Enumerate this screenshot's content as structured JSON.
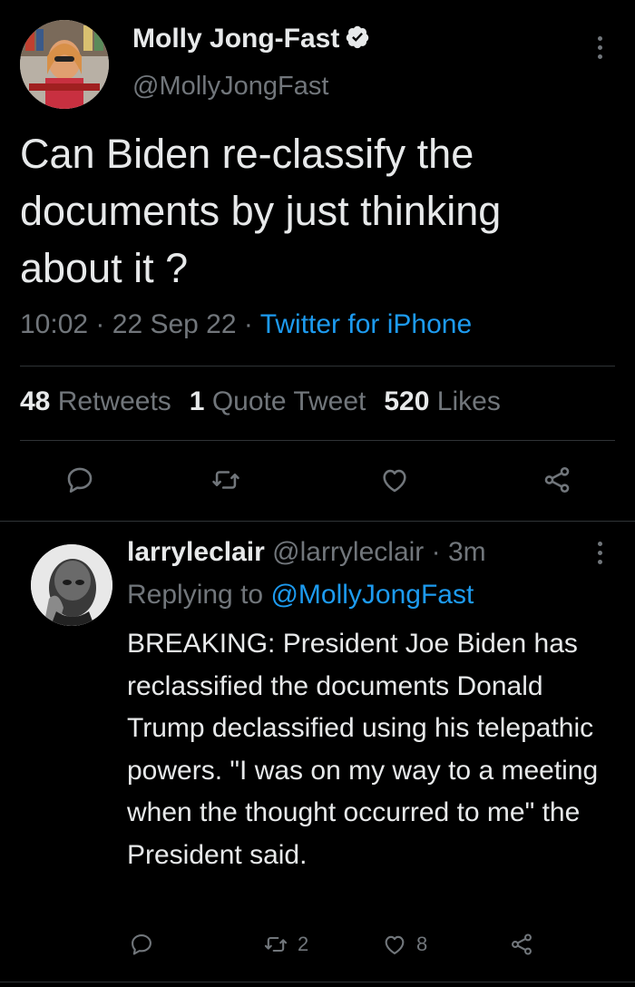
{
  "tweet": {
    "author_name": "Molly Jong-Fast",
    "author_handle": "@MollyJongFast",
    "text": "Can Biden re-classify the documents by just thinking about it ?",
    "time": "10:02",
    "dot1": "·",
    "date": "22 Sep 22",
    "dot2": "·",
    "source": "Twitter for iPhone",
    "stats": {
      "retweets_count": "48",
      "retweets_label": "Retweets",
      "quotes_count": "1",
      "quotes_label": "Quote Tweet",
      "likes_count": "520",
      "likes_label": "Likes"
    }
  },
  "reply": {
    "author_name": "larryleclair",
    "author_handle": "@larryleclair",
    "dot": "·",
    "time": "3m",
    "replying_label": "Replying to",
    "replying_handle": "@MollyJongFast",
    "text": "BREAKING: President Joe Biden has reclassified the documents Donald Trump declassified using his telepathic powers. \"I was on my way to a meeting when the thought occurred to me\" the President said.",
    "retweet_count": "2",
    "like_count": "8"
  },
  "colors": {
    "background": "#000000",
    "text": "#e7e9ea",
    "muted": "#71767b",
    "accent": "#1d9bf0",
    "divider": "#2f3336"
  },
  "icons": [
    "verified-badge-icon",
    "more-options-icon",
    "reply-icon",
    "retweet-icon",
    "like-icon",
    "share-icon"
  ]
}
